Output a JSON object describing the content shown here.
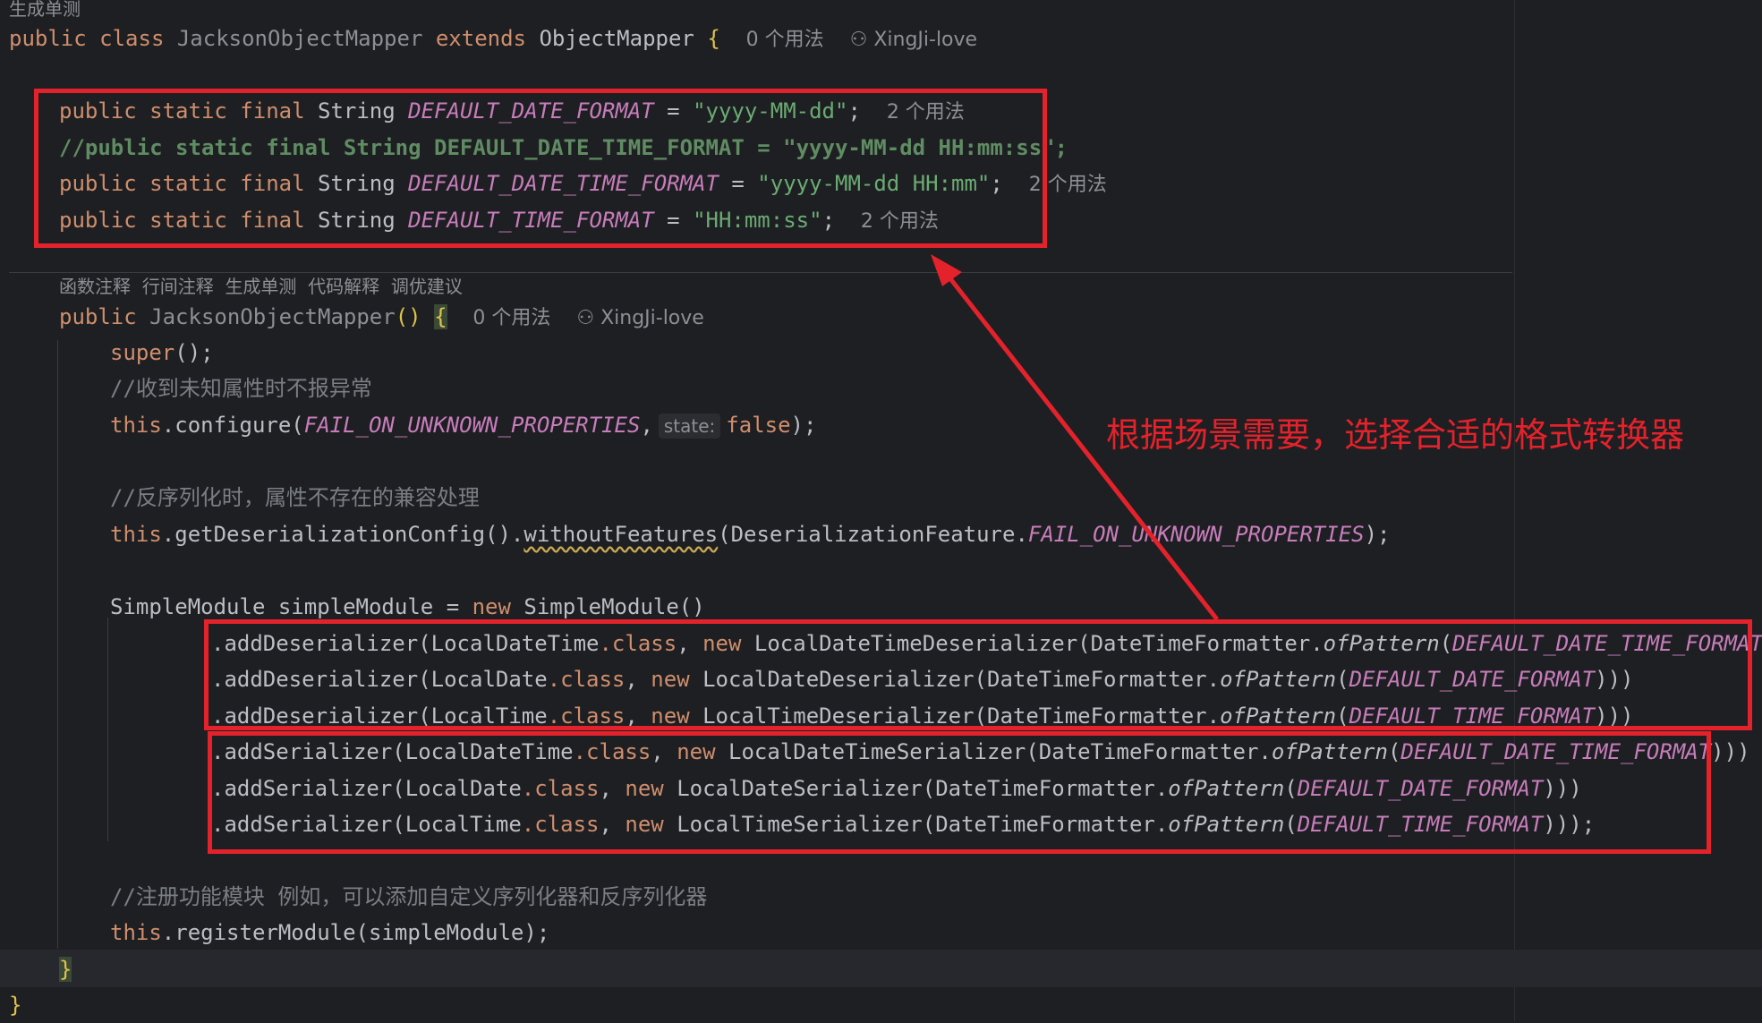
{
  "lens": {
    "class_lens": "生成单测",
    "method_lens": [
      "函数注释",
      "行间注释",
      "生成单测",
      "代码解释",
      "调优建议"
    ]
  },
  "class_decl": {
    "kw_public": "public",
    "kw_class": "class",
    "class_name": "JacksonObjectMapper",
    "kw_extends": "extends",
    "parent": "ObjectMapper",
    "brace": "{",
    "usages": "0 个用法",
    "author": "XingJi-love"
  },
  "fields": [
    {
      "mods": "public static final",
      "type": "String",
      "name": "DEFAULT_DATE_FORMAT",
      "eq": "=",
      "value": "\"yyyy-MM-dd\"",
      "end": ";",
      "usages": "2 个用法"
    },
    {
      "comment": "//public static final String DEFAULT_DATE_TIME_FORMAT = \"yyyy-MM-dd HH:mm:ss\";"
    },
    {
      "mods": "public static final",
      "type": "String",
      "name": "DEFAULT_DATE_TIME_FORMAT",
      "eq": "=",
      "value": "\"yyyy-MM-dd HH:mm\"",
      "end": ";",
      "usages": "2 个用法"
    },
    {
      "mods": "public static final",
      "type": "String",
      "name": "DEFAULT_TIME_FORMAT",
      "eq": "=",
      "value": "\"HH:mm:ss\"",
      "end": ";",
      "usages": "2 个用法"
    }
  ],
  "ctor": {
    "kw_public": "public",
    "name": "JacksonObjectMapper",
    "parens": "()",
    "brace": "{",
    "usages": "0 个用法",
    "author": "XingJi-love"
  },
  "body": {
    "super_call": "super",
    "super_rest": "();",
    "comment1": "//收到未知属性时不报异常",
    "cfg_this": "this",
    "cfg_method": ".configure(",
    "cfg_const": "FAIL_ON_UNKNOWN_PROPERTIES",
    "cfg_comma": ",",
    "cfg_hint": "state:",
    "cfg_false": "false",
    "cfg_end": ");",
    "comment2": "//反序列化时，属性不存在的兼容处理",
    "deser_this": "this",
    "deser_get": ".getDeserializationConfig().",
    "deser_method": "withoutFeatures",
    "deser_open": "(DeserializationFeature.",
    "deser_const": "FAIL_ON_UNKNOWN_PROPERTIES",
    "deser_end": ");",
    "sm_type": "SimpleModule simpleModule",
    "sm_eq": "=",
    "sm_new": "new",
    "sm_ctor": "SimpleModule()",
    "comment3": "//注册功能模块 例如，可以添加自定义序列化器和反序列化器",
    "reg_this": "this",
    "reg_rest": ".registerModule(simpleModule);",
    "ctor_close": "}",
    "class_close": "}"
  },
  "chain": [
    {
      "method": ".addDeserializer(",
      "cls": "LocalDateTime",
      "dotclass": ".class",
      "comma": ",",
      "kw_new": "new",
      "ser": "LocalDateTimeDeserializer(DateTimeFormatter.",
      "of": "ofPattern",
      "open": "(",
      "const": "DEFAULT_DATE_TIME_FORMAT",
      "end": ")))"
    },
    {
      "method": ".addDeserializer(",
      "cls": "LocalDate",
      "dotclass": ".class",
      "comma": ",",
      "kw_new": "new",
      "ser": "LocalDateDeserializer(DateTimeFormatter.",
      "of": "ofPattern",
      "open": "(",
      "const": "DEFAULT_DATE_FORMAT",
      "end": ")))"
    },
    {
      "method": ".addDeserializer(",
      "cls": "LocalTime",
      "dotclass": ".class",
      "comma": ",",
      "kw_new": "new",
      "ser": "LocalTimeDeserializer(DateTimeFormatter.",
      "of": "ofPattern",
      "open": "(",
      "const": "DEFAULT_TIME_FORMAT",
      "end": ")))"
    },
    {
      "method": ".addSerializer(",
      "cls": "LocalDateTime",
      "dotclass": ".class",
      "comma": ",",
      "kw_new": "new",
      "ser": "LocalDateTimeSerializer(DateTimeFormatter.",
      "of": "ofPattern",
      "open": "(",
      "const": "DEFAULT_DATE_TIME_FORMAT",
      "end": ")))"
    },
    {
      "method": ".addSerializer(",
      "cls": "LocalDate",
      "dotclass": ".class",
      "comma": ",",
      "kw_new": "new",
      "ser": "LocalDateSerializer(DateTimeFormatter.",
      "of": "ofPattern",
      "open": "(",
      "const": "DEFAULT_DATE_FORMAT",
      "end": ")))"
    },
    {
      "method": ".addSerializer(",
      "cls": "LocalTime",
      "dotclass": ".class",
      "comma": ",",
      "kw_new": "new",
      "ser": "LocalTimeSerializer(DateTimeFormatter.",
      "of": "ofPattern",
      "open": "(",
      "const": "DEFAULT_TIME_FORMAT",
      "end": ")));"
    }
  ],
  "annotation": {
    "text": "根据场景需要，选择合适的格式转换器",
    "color": "#e3222b"
  },
  "colors": {
    "background": "#1e1f22",
    "keyword": "#cf8e6d",
    "constant": "#c77dbb",
    "string": "#6aab73",
    "annotation": "#e3222b"
  }
}
